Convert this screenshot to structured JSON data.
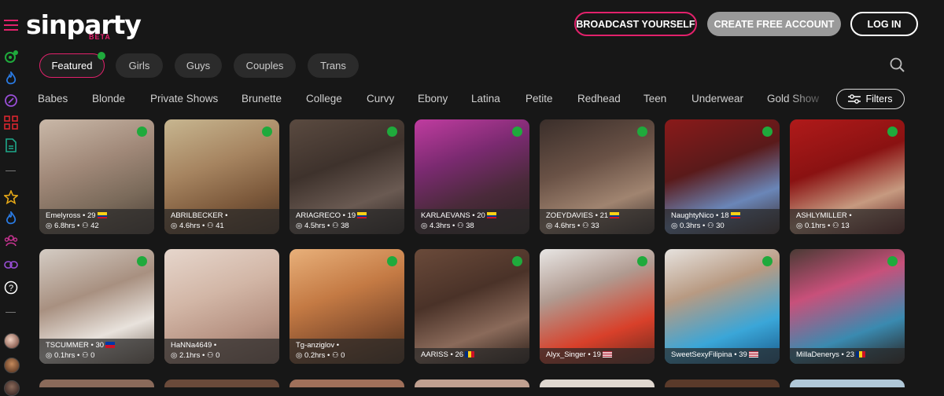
{
  "logo": {
    "text": "sinparty",
    "sub": "BETA"
  },
  "header": {
    "broadcast": "BROADCAST YOURSELF",
    "create": "CREATE FREE ACCOUNT",
    "login": "LOG IN"
  },
  "tabs": [
    "Featured",
    "Girls",
    "Guys",
    "Couples",
    "Trans"
  ],
  "categories": [
    "Babes",
    "Blonde",
    "Private Shows",
    "Brunette",
    "College",
    "Curvy",
    "Ebony",
    "Latina",
    "Petite",
    "Redhead",
    "Teen",
    "Underwear",
    "Gold Show"
  ],
  "filters_label": "Filters",
  "row1": [
    {
      "name": "Emelyross",
      "age": "29",
      "flag": "colombia",
      "hours": "6.8hrs",
      "viewers": "42"
    },
    {
      "name": "ABRILBECKER",
      "age": "",
      "flag": "",
      "hours": "4.6hrs",
      "viewers": "41"
    },
    {
      "name": "ARIAGRECO",
      "age": "19",
      "flag": "colombia",
      "hours": "4.5hrs",
      "viewers": "38"
    },
    {
      "name": "KARLAEVANS",
      "age": "20",
      "flag": "colombia",
      "hours": "4.3hrs",
      "viewers": "38"
    },
    {
      "name": "ZOEYDAVIES",
      "age": "21",
      "flag": "colombia",
      "hours": "4.6hrs",
      "viewers": "33"
    },
    {
      "name": "NaughtyNico",
      "age": "18",
      "flag": "colombia",
      "hours": "0.3hrs",
      "viewers": "30"
    },
    {
      "name": "ASHLYMILLER",
      "age": "",
      "flag": "",
      "hours": "0.1hrs",
      "viewers": "13"
    }
  ],
  "row2": [
    {
      "name": "TSCUMMER",
      "age": "30",
      "flag": "philippines",
      "hours": "0.1hrs",
      "viewers": "0"
    },
    {
      "name": "HaNNa4649",
      "age": "",
      "flag": "",
      "hours": "2.1hrs",
      "viewers": "0"
    },
    {
      "name": "Tg-anziglov",
      "age": "",
      "flag": "",
      "hours": "0.2hrs",
      "viewers": "0"
    },
    {
      "name": "AARISS",
      "age": "26",
      "flag": "romania",
      "hours": "",
      "viewers": ""
    },
    {
      "name": "Alyx_Singer",
      "age": "19",
      "flag": "usa",
      "hours": "",
      "viewers": ""
    },
    {
      "name": "SweetSexyFilipina",
      "age": "39",
      "flag": "usa",
      "hours": "",
      "viewers": ""
    },
    {
      "name": "MillaDenerys",
      "age": "23",
      "flag": "romania",
      "hours": "",
      "viewers": ""
    }
  ],
  "colors": {
    "accent": "#e2216b",
    "live": "#1faa3c",
    "background": "#171717"
  }
}
